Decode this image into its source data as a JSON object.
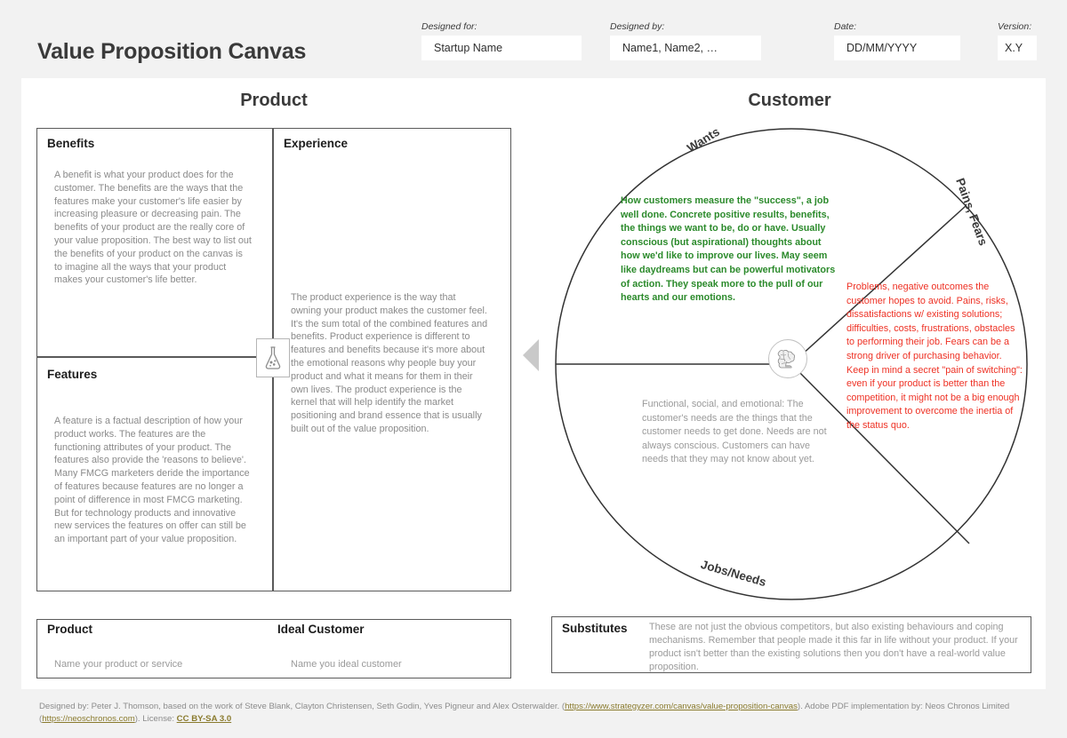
{
  "header": {
    "title": "Value Proposition Canvas",
    "fields": [
      {
        "label": "Designed for:",
        "value": "Startup Name"
      },
      {
        "label": "Designed by:",
        "value": "Name1, Name2, …"
      },
      {
        "label": "Date:",
        "value": "DD/MM/YYYY"
      },
      {
        "label": "Version:",
        "value": "X.Y"
      }
    ]
  },
  "columns": {
    "product": "Product",
    "customer": "Customer"
  },
  "product": {
    "benefits": {
      "title": "Benefits",
      "body": "A benefit is what your product does for the customer. The benefits are the ways that the features make your customer's life easier by increasing pleasure or decreasing pain. The benefits of your product are the really core of your value proposition. The best way to list out the benefits of your product on the canvas is to imagine all the ways that your product makes your customer's life better."
    },
    "features": {
      "title": "Features",
      "body": "A feature is a factual description of how your product works. The features are the functioning attributes of your product. The features also provide the 'reasons to believe'. Many FMCG marketers deride the importance of features because features are no longer a point of difference in most FMCG marketing. But for technology products and innovative new services the features on offer can still be an important part of your value proposition."
    },
    "experience": {
      "title": "Experience",
      "body": "The product experience is the way that owning your product makes the customer feel. It's the sum total of the combined features and benefits. Product experience is different to features and benefits because it's more about the emotional reasons why people buy your product and what it means for them in their own lives. The product experience is the kernel that will help identify the market positioning and brand essence that is usually built out of the value proposition."
    }
  },
  "customer": {
    "wants": {
      "label": "Wants",
      "body": "How customers measure the \"success\", a job well done. Concrete positive results, benefits, the things we want to be, do or have. Usually conscious (but aspirational) thoughts about how we'd like to improve our lives. May seem like daydreams but can be powerful motivators of action. They speak more to the pull of our hearts and our emotions.",
      "color": "#2b8a2b"
    },
    "pains": {
      "label": "Pains, Fears",
      "body": "Problems, negative outcomes the customer hopes to avoid. Pains, risks, dissatisfactions w/ existing solutions; difficulties, costs, frustrations, obstacles to performing their job. Fears can be a strong driver of purchasing behavior. Keep in mind a secret \"pain of switching\": even if your product is better than the competition, it might not be a big enough improvement to overcome the inertia of the status quo.",
      "color": "#ee3124"
    },
    "jobs": {
      "label": "Jobs/Needs",
      "body": "Functional, social, and emotional: The customer's needs are the things that the customer needs to get done. Needs are not always conscious. Customers can have needs that they may not know about yet.",
      "color": "#9a9a9a"
    }
  },
  "bottom": {
    "product": {
      "title": "Product",
      "placeholder": "Name your product or service"
    },
    "ideal_customer": {
      "title": "Ideal Customer",
      "placeholder": "Name you ideal customer"
    },
    "substitutes": {
      "title": "Substitutes",
      "body": "These are not just the obvious competitors, but also existing behaviours and coping mechanisms. Remember that people made it this far in life without your product. If your product isn't better than the existing solutions then you don't have a real-world value proposition."
    }
  },
  "footer": {
    "part1": "Designed by: Peter J. Thomson, based on the work of Steve Blank, Clayton Christensen, Seth Godin, Yves Pigneur and Alex Osterwalder. (",
    "link1": "https://www.strategyzer.com/canvas/value-proposition-canvas",
    "part2": "). Adobe PDF implementation by: Neos Chronos Limited (",
    "link2": "https://neoschronos.com",
    "part3": "). License: ",
    "license": "CC BY-SA 3.0"
  },
  "icons": {
    "flask": "flask-icon",
    "brain": "brain-icon",
    "arrow": "arrow-left-icon"
  }
}
